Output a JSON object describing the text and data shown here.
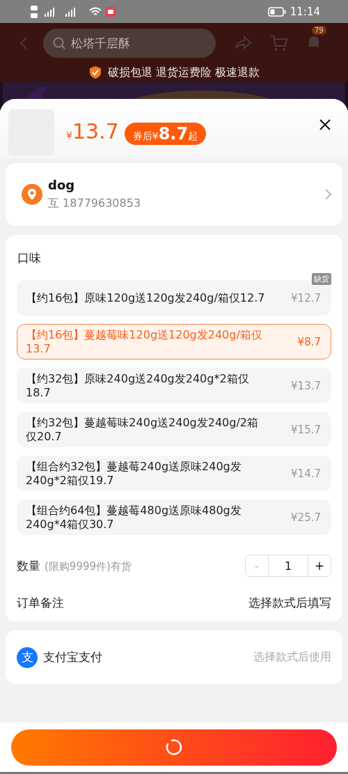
{
  "status_bar": {
    "time": "11:14"
  },
  "nav": {
    "search_placeholder": "松塔千层酥",
    "cart_badge": "79"
  },
  "guarantee": "破损包退 退货运费险 极速退款",
  "product": {
    "currency": "¥",
    "price": "13.7",
    "coupon_prefix": "券后¥",
    "coupon_price": "8.7",
    "coupon_suffix": "起"
  },
  "address": {
    "name": "dog",
    "phone": "互 18779630853"
  },
  "flavor": {
    "label": "口味",
    "options": [
      {
        "text": "【约16包】原味120g送120g发240g/箱仅12.7",
        "price": "¥12.7",
        "selected": false,
        "badge": "缺货"
      },
      {
        "text": "【约16包】蔓越莓味120g送120g发240g/箱仅13.7",
        "price": "¥8.7",
        "selected": true
      },
      {
        "text": "【约32包】原味240g送240g发240g*2箱仅18.7",
        "price": "¥13.7",
        "selected": false
      },
      {
        "text": "【约32包】蔓越莓味240g送240g发240g/2箱仅20.7",
        "price": "¥15.7",
        "selected": false
      },
      {
        "text": "【组合约32包】蔓越莓240g送原味240g发240g*2箱仅19.7",
        "price": "¥14.7",
        "selected": false
      },
      {
        "text": "【组合约64包】蔓越莓480g送原味480g发240g*4箱仅30.7",
        "price": "¥25.7",
        "selected": false
      }
    ]
  },
  "quantity": {
    "label": "数量",
    "hint": "(限购9999件)有货",
    "minus": "-",
    "value": "1",
    "plus": "+",
    "minus_disabled": true
  },
  "note": {
    "label": "订单备注",
    "value": "选择款式后填写"
  },
  "payment": {
    "icon_char": "支",
    "label": "支付宝支付",
    "value": "选择款式后使用"
  }
}
